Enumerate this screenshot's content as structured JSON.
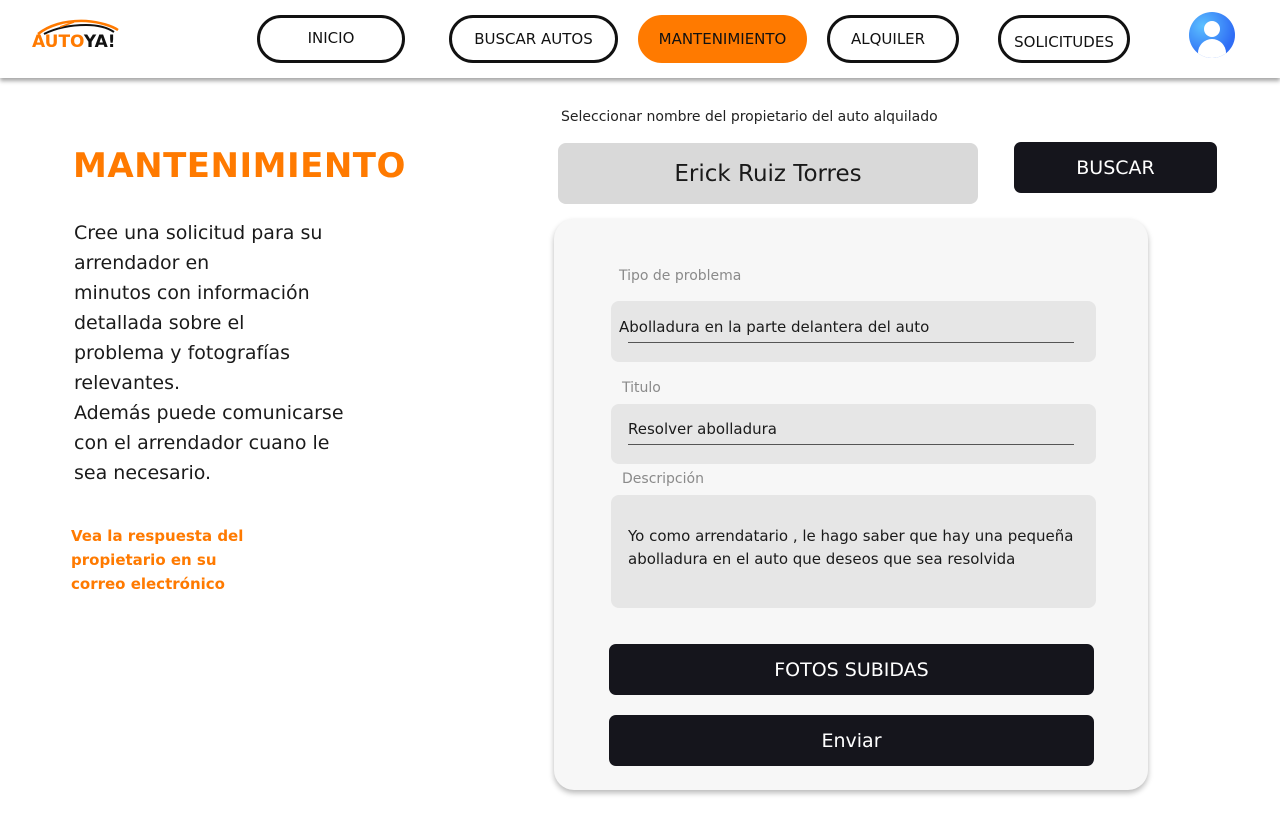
{
  "brand": {
    "part1": "AUTO",
    "part2": "YA!"
  },
  "nav": {
    "inicio": "INICIO",
    "buscar_autos": "BUSCAR AUTOS",
    "mantenimiento": "MANTENIMIENTO",
    "alquiler": "ALQUILER",
    "solicitudes": "SOLICITUDES",
    "active": "MANTENIMIENTO"
  },
  "page": {
    "title": "MANTENIMIENTO",
    "intro_lines": [
      "Cree una solicitud para su",
      " arrendador en",
      "minutos con información",
      "detallada sobre el",
      "problema y fotografías",
      "relevantes.",
      "Además puede comunicarse",
      "con el arrendador cuano le",
      "sea necesario."
    ],
    "note_lines": [
      "Vea la respuesta del",
      "propietario en su",
      "correo electrónico"
    ]
  },
  "search": {
    "label": "Seleccionar  nombre del propietario del auto  alquilado",
    "owner_value": "Erick Ruiz Torres",
    "button_label": "BUSCAR"
  },
  "form": {
    "problem_type": {
      "label": "Tipo de problema",
      "value": "Abolladura en la parte delantera del auto"
    },
    "title": {
      "label": "Titulo",
      "value": "Resolver abolladura"
    },
    "description": {
      "label": "Descripción",
      "lines": [
        "Yo como arrendatario , le hago saber que hay una pequeña",
        "abolladura en el auto que deseos que sea resolvida"
      ]
    },
    "photos_button": "FOTOS SUBIDAS",
    "submit_button": "Enviar"
  },
  "colors": {
    "accent": "#ff7a00",
    "dark": "#15151c",
    "field_bg": "#e6e6e6",
    "avatar": "#2f6df5"
  },
  "icons": {
    "avatar": "user-avatar-icon",
    "logo": "car-logo-icon"
  }
}
